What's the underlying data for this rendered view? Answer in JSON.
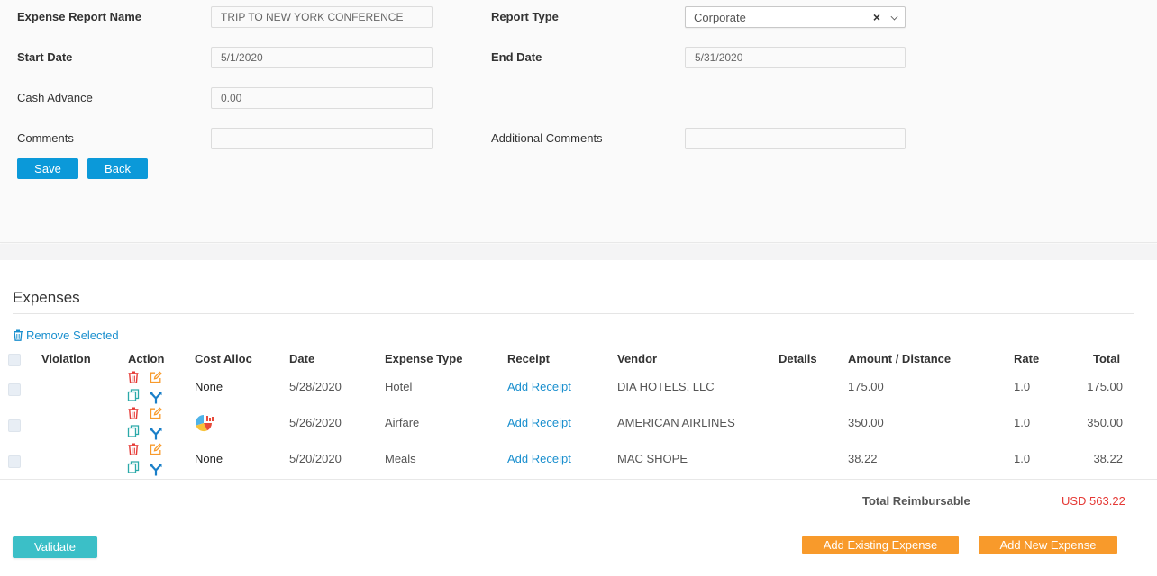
{
  "form": {
    "report_name_label": "Expense Report Name",
    "report_name_value": "TRIP TO NEW YORK CONFERENCE",
    "report_type_label": "Report Type",
    "report_type_value": "Corporate",
    "start_date_label": "Start Date",
    "start_date_value": "5/1/2020",
    "end_date_label": "End Date",
    "end_date_value": "5/31/2020",
    "cash_advance_label": "Cash Advance",
    "cash_advance_value": "0.00",
    "comments_label": "Comments",
    "comments_value": "",
    "additional_comments_label": "Additional Comments",
    "additional_comments_value": "",
    "save_label": "Save",
    "back_label": "Back"
  },
  "expenses": {
    "title": "Expenses",
    "remove_selected_label": "Remove Selected",
    "columns": [
      "Violation",
      "Action",
      "Cost Alloc",
      "Date",
      "Expense Type",
      "Receipt",
      "Vendor",
      "Details",
      "Amount / Distance",
      "Rate",
      "Total"
    ],
    "rows": [
      {
        "cost_alloc": "None",
        "date": "5/28/2020",
        "type": "Hotel",
        "receipt": "Add Receipt",
        "vendor": "DIA HOTELS, LLC",
        "details": "",
        "amount": "175.00",
        "rate": "1.0",
        "total": "175.00"
      },
      {
        "cost_alloc": "",
        "date": "5/26/2020",
        "type": "Airfare",
        "receipt": "Add Receipt",
        "vendor": "AMERICAN AIRLINES",
        "details": "",
        "amount": "350.00",
        "rate": "1.0",
        "total": "350.00"
      },
      {
        "cost_alloc": "None",
        "date": "5/20/2020",
        "type": "Meals",
        "receipt": "Add Receipt",
        "vendor": "MAC SHOPE",
        "details": "",
        "amount": "38.22",
        "rate": "1.0",
        "total": "38.22"
      }
    ],
    "total_label": "Total Reimbursable",
    "total_value": "USD 563.22"
  },
  "footer": {
    "validate_label": "Validate",
    "add_existing_label": "Add Existing Expense",
    "add_new_label": "Add New Expense"
  },
  "icons": {
    "remove": "trash-icon",
    "delete": "trash-icon",
    "edit": "edit-icon",
    "copy": "copy-icon",
    "split": "split-icon",
    "cost_alloc_chart": "pie-chart-icon",
    "select_clear": "close-icon",
    "select_open": "chevron-down-icon"
  },
  "colors": {
    "primary_button": "#0b99d9",
    "link": "#1a8fce",
    "validate_button": "#3bbfc7",
    "add_buttons": "#f89a2b",
    "total_value": "#e53935",
    "delete_icon": "#e53935",
    "edit_icon": "#f89a2b",
    "copy_icon": "#2aa9a9",
    "split_icon": "#1a7fc8"
  }
}
